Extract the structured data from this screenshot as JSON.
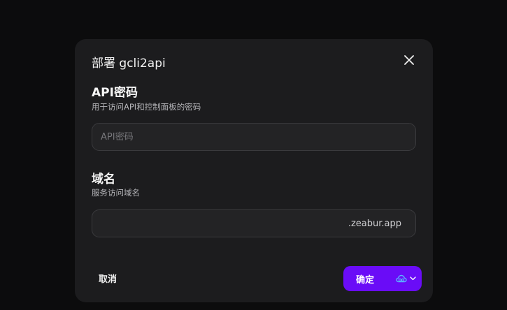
{
  "dialog": {
    "title": "部署 gcli2api",
    "close_icon": "close-icon"
  },
  "api_password": {
    "label": "API密码",
    "description": "用于访问API和控制面板的密码",
    "placeholder": "API密码",
    "value": ""
  },
  "domain": {
    "label": "域名",
    "description": "服务访问域名",
    "value": "",
    "suffix": ".zeabur.app"
  },
  "footer": {
    "cancel_label": "取消",
    "confirm_label": "确定",
    "region_icon": "cloud-icon",
    "dropdown_icon": "chevron-down-icon"
  },
  "colors": {
    "accent": "#6a0cf7",
    "dialog_bg": "#1c1c1e",
    "page_bg": "#0c0c0d"
  }
}
